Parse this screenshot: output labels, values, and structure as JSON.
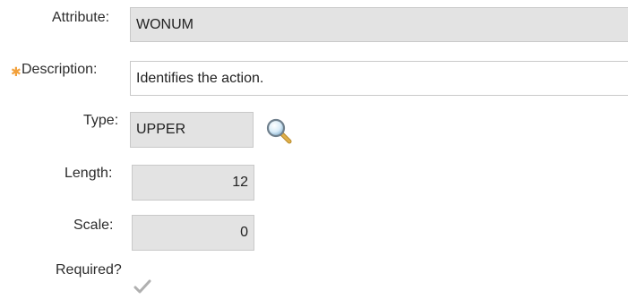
{
  "form": {
    "attribute": {
      "label": "Attribute:",
      "value": "WONUM"
    },
    "description": {
      "label": "Description:",
      "value": "Identifies the action.",
      "required_marker": "✱"
    },
    "type": {
      "label": "Type:",
      "value": "UPPER",
      "lookup_icon": "magnifier-icon"
    },
    "length": {
      "label": "Length:",
      "value": "12"
    },
    "scale": {
      "label": "Scale:",
      "value": "0"
    },
    "required": {
      "label": "Required?",
      "checked": true
    }
  }
}
